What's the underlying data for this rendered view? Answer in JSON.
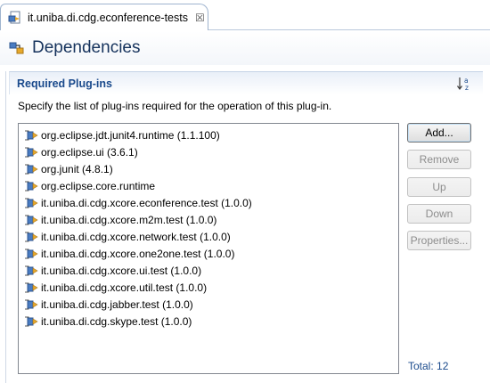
{
  "tab": {
    "title": "it.uniba.di.cdg.econference-tests",
    "close_glyph": "☒"
  },
  "form": {
    "title": "Dependencies"
  },
  "section": {
    "title": "Required Plug-ins",
    "description": "Specify the list of plug-ins required for the operation of this plug-in."
  },
  "plugins": [
    "org.eclipse.jdt.junit4.runtime (1.1.100)",
    "org.eclipse.ui (3.6.1)",
    "org.junit (4.8.1)",
    "org.eclipse.core.runtime",
    "it.uniba.di.cdg.xcore.econference.test (1.0.0)",
    "it.uniba.di.cdg.xcore.m2m.test (1.0.0)",
    "it.uniba.di.cdg.xcore.network.test (1.0.0)",
    "it.uniba.di.cdg.xcore.one2one.test (1.0.0)",
    "it.uniba.di.cdg.xcore.ui.test (1.0.0)",
    "it.uniba.di.cdg.xcore.util.test (1.0.0)",
    "it.uniba.di.cdg.jabber.test (1.0.0)",
    "it.uniba.di.cdg.skype.test (1.0.0)"
  ],
  "buttons": {
    "add": "Add...",
    "remove": "Remove",
    "up": "Up",
    "down": "Down",
    "properties": "Properties..."
  },
  "total": "Total: 12",
  "icons": {
    "tab": "plugin-manifest-icon",
    "form": "dependencies-icon",
    "sort": "sort-alphabetical-icon",
    "plugin": "plugin-icon"
  },
  "colors": {
    "section_title": "#1a4a8c",
    "form_title": "#15325c"
  }
}
